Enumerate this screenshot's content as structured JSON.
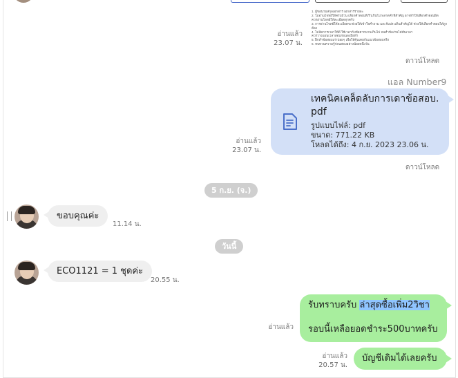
{
  "document_preview": {
    "lines": [
      "1. ผู้ขอนามสกุลเอกสาร เอกสารรายละ",
      "2. ไม่อ่านโจทย์ให้ครบถ้วน เลือกคำตอบที่เร็วเกินไป พลาดคำที่สำคัญ อาจทำให้เลือกคำตอบผิด",
      "   ควรอ่านโจทย์ให้ละเอียดทุกครั้ง",
      "3. การอ่านโจทย์ให้ละเอียดจะช่วยให้เข้าใจคำถาม และจับประเด็นสำคัญได้ ช่วยให้เลือกคำตอบได้ถูก",
      "   ต้อง",
      "4. ไม่จัดการเวลาให้ดี ใช้เวลากับข้อยากนานเกินไป จนทำข้อง่ายไม่ทันเวลา",
      "   ควรวางแผนเวลาสอบก่อนลงมือทำ",
      "5. ฝึกทำข้อสอบเก่าบ่อยๆ เพื่อให้คุ้นเคยกับแนวข้อสอบจริง",
      "6. ทบทวนความรู้ก่อนสอบอย่างน้อยหนึ่งวัน"
    ]
  },
  "messages": {
    "m1": {
      "read": "อ่านแล้ว",
      "time": "23.07 น.",
      "download": "ดาวน์โหลด"
    },
    "sender": "แอล Number9",
    "file": {
      "name": "เทคนิคเคล็ดลับการเดาข้อสอบ.pdf",
      "type": "รูปแบบไฟล์: pdf",
      "size": "ขนาด: 771.22 KB",
      "expiry": "โหลดได้ถึง: 4 ก.ย. 2023 23.06 น.",
      "read": "อ่านแล้ว",
      "time": "23.07 น.",
      "download": "ดาวน์โหลด"
    },
    "date1": "5 ก.ย. (จ.)",
    "in1": {
      "text": "ขอบคุณค่ะ",
      "time": "11.14 น."
    },
    "date2": "วันนี้",
    "in2": {
      "text": "ECO1121 = 1 ชุดค่ะ",
      "time": "20.55 น."
    },
    "out1": {
      "text_before": "รับทราบครับ ",
      "text_highlight": "ล่าสุดซื้อเพิ่ม2วิชา",
      "line2": "รอบนี้เหลือยอดชำระ500บาทครับ",
      "read": "อ่านแล้ว"
    },
    "out2": {
      "text": "บัญชีเดิมได้เลยครับ",
      "read": "อ่านแล้ว",
      "time": "20.57 น."
    }
  },
  "colors": {
    "file_bubble": "#d3e0f7",
    "outgoing_bubble": "#a8ee9e",
    "incoming_bubble": "#efefef",
    "date_pill": "#cfcfcf",
    "text_highlight": "#8fc4ff"
  }
}
